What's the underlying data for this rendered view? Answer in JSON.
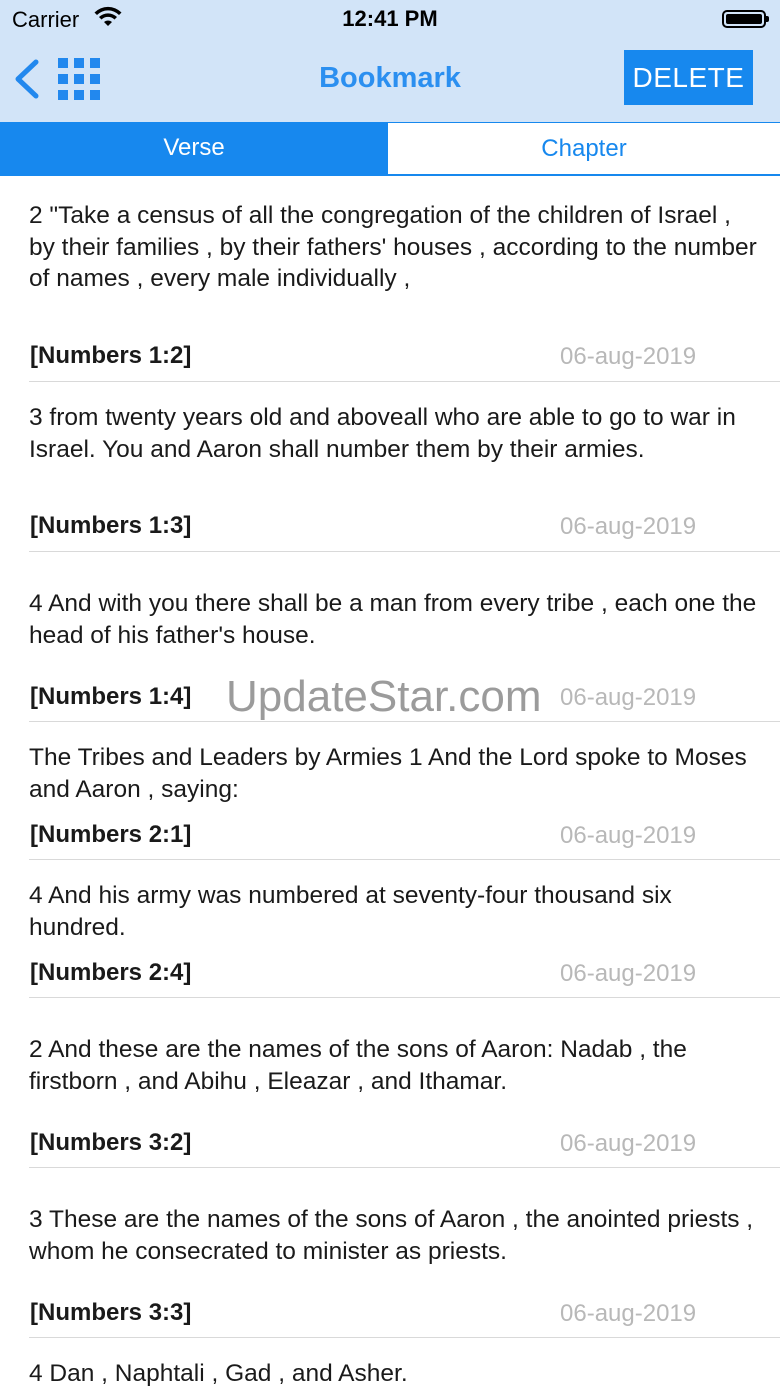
{
  "status_bar": {
    "carrier": "Carrier",
    "time": "12:41 PM"
  },
  "nav": {
    "title": "Bookmark",
    "delete_label": "DELETE"
  },
  "tabs": [
    {
      "label": "Verse",
      "active": true
    },
    {
      "label": "Chapter",
      "active": false
    }
  ],
  "bookmarks": [
    {
      "text": " 2 \"Take a census of all the congregation of the children of Israel , by their families , by their fathers' houses , according to the number of names , every male individually ,",
      "ref": "[Numbers 1:2]",
      "date": "06-aug-2019"
    },
    {
      "text": " 3 from twenty years old and aboveall who are able to go to war in Israel. You and Aaron shall number them by their armies.",
      "ref": "[Numbers 1:3]",
      "date": "06-aug-2019"
    },
    {
      "text": " 4 And with you there shall be a man from every tribe , each one the head of his father's house.",
      "ref": "[Numbers 1:4]",
      "date": "06-aug-2019"
    },
    {
      "text": " The Tribes and Leaders by Armies  1 And the Lord spoke to Moses and Aaron , saying:",
      "ref": "[Numbers 2:1]",
      "date": "06-aug-2019"
    },
    {
      "text": " 4 And his army was numbered at seventy-four thousand six hundred.",
      "ref": "[Numbers 2:4]",
      "date": "06-aug-2019"
    },
    {
      "text": " 2 And these are the names of the sons of Aaron: Nadab , the firstborn , and Abihu , Eleazar , and Ithamar.",
      "ref": "[Numbers 3:2]",
      "date": "06-aug-2019"
    },
    {
      "text": " 3 These are the names of the sons of Aaron , the anointed priests , whom he consecrated to minister as priests.",
      "ref": "[Numbers 3:3]",
      "date": "06-aug-2019"
    },
    {
      "text": " 4 Dan , Naphtali , Gad , and Asher.",
      "ref": "",
      "date": ""
    }
  ],
  "watermark": "UpdateStar.com",
  "colors": {
    "accent": "#1788ee",
    "header_bg": "#d2e4f8",
    "date_gray": "#b8b8b8"
  }
}
